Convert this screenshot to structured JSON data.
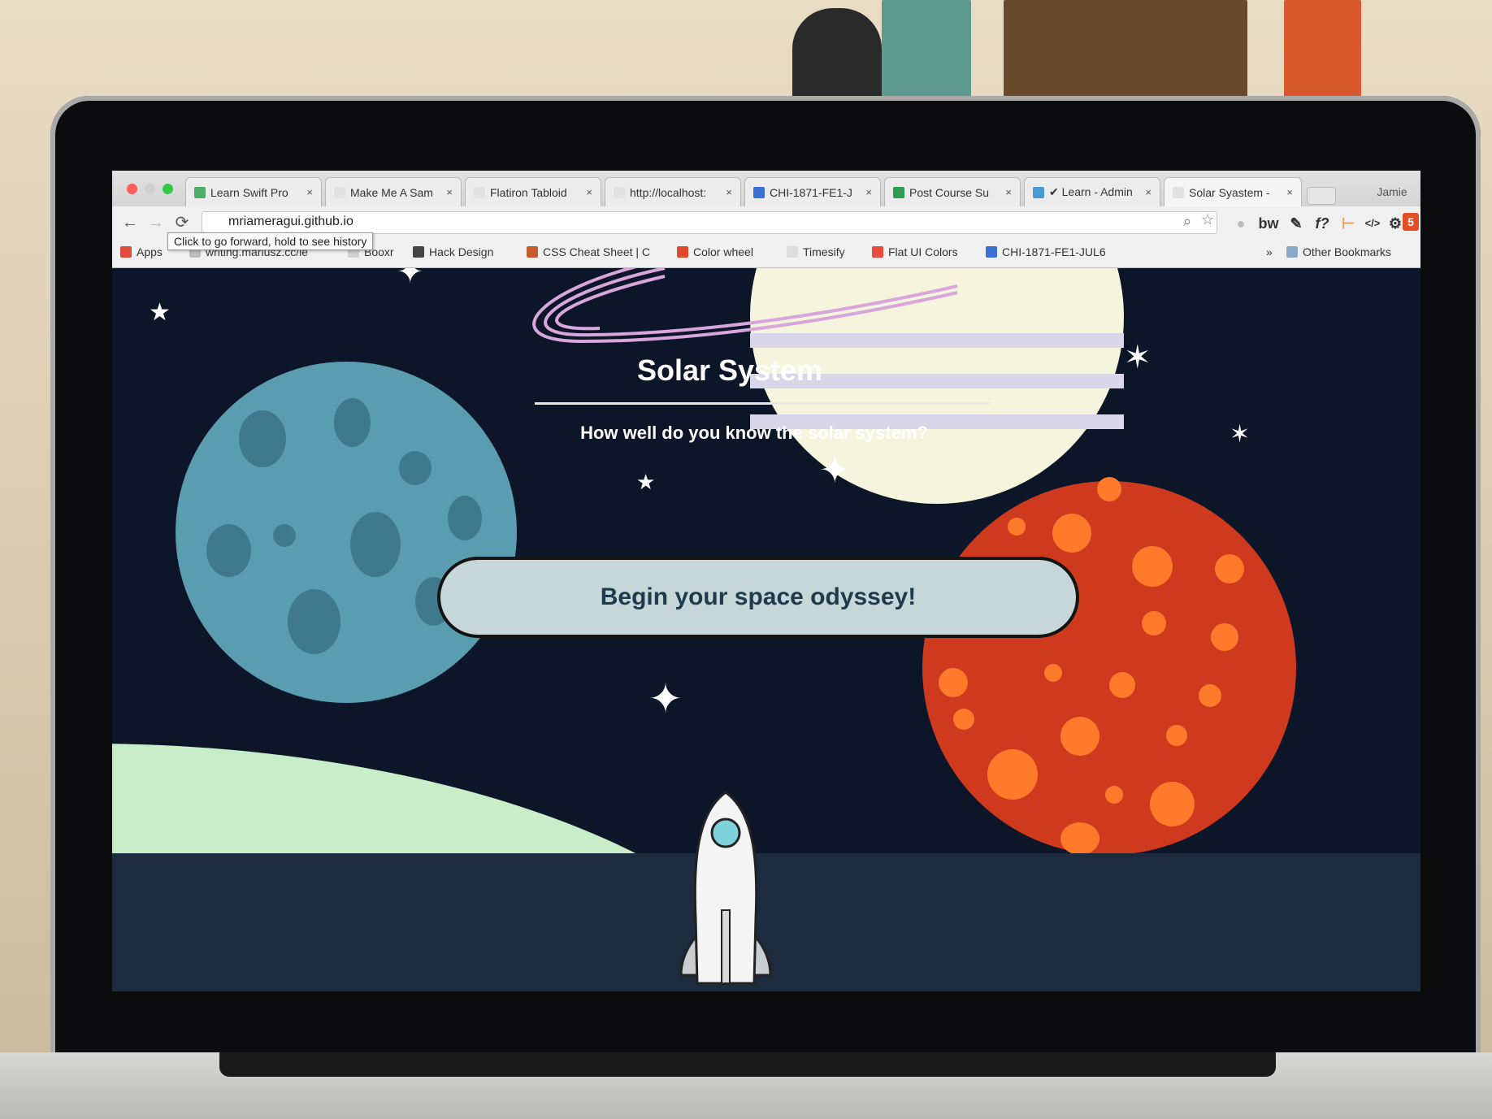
{
  "browser": {
    "tabs": [
      {
        "label": "Learn Swift Pro",
        "favicon_color": "#4cae6a"
      },
      {
        "label": "Make Me A Sam",
        "favicon_color": "#e2e2e2"
      },
      {
        "label": "Flatiron Tabloid",
        "favicon_color": "#e2e2e2"
      },
      {
        "label": "http://localhost:",
        "favicon_color": "#e2e2e2"
      },
      {
        "label": "CHI-1871-FE1-J",
        "favicon_color": "#3b6fd4"
      },
      {
        "label": "Post Course Su",
        "favicon_color": "#2e9a52"
      },
      {
        "label": "✔ Learn - Admin",
        "favicon_color": "#4a9ad8"
      },
      {
        "label": "Solar Syastem -",
        "favicon_color": "#e2e2e2"
      }
    ],
    "profile_name": "Jamie",
    "close_glyph": "×",
    "address": "mriameragui.github.io",
    "tooltip": "Click to go forward, hold to see history",
    "nav": {
      "back": "←",
      "forward": "→",
      "reload": "⟳"
    },
    "bookmarks": [
      {
        "label": "Apps",
        "icon_color": "#e24c3c"
      },
      {
        "label": "writing.mariusz.cc/le",
        "icon_color": "#bdbdbd"
      },
      {
        "label": "Booxr",
        "icon_color": "#cfcfcf"
      },
      {
        "label": "Hack Design",
        "icon_color": "#444444"
      },
      {
        "label": "CSS Cheat Sheet | C",
        "icon_color": "#c55a2a"
      },
      {
        "label": "Color wheel",
        "icon_color": "#e04a2a"
      },
      {
        "label": "Timesify",
        "icon_color": "#dddddd"
      },
      {
        "label": "Flat UI Colors",
        "icon_color": "#e84c3d"
      },
      {
        "label": "CHI-1871-FE1-JUL6",
        "icon_color": "#3b6fd4"
      }
    ],
    "bookmarks_overflow": "»",
    "other_bookmarks": "Other Bookmarks",
    "extensions": [
      {
        "name": "bw-icon",
        "glyph": "bw"
      },
      {
        "name": "eyedropper-icon",
        "glyph": "✎"
      },
      {
        "name": "function-icon",
        "glyph": "f?"
      },
      {
        "name": "ruler-icon",
        "glyph": "⊢"
      },
      {
        "name": "code-icon",
        "glyph": "</>"
      },
      {
        "name": "gear-icon",
        "glyph": "⚙"
      },
      {
        "name": "html5-icon",
        "glyph": "5"
      },
      {
        "name": "menu-icon",
        "glyph": "≡"
      }
    ]
  },
  "page": {
    "title": "Solar System",
    "subtitle": "How well do you know the solar system?",
    "cta_label": "Begin your space odyssey!"
  },
  "colors": {
    "space": "#0d1628",
    "blue_planet": "#5b9db0",
    "red_planet": "#cf3a1f",
    "cta_bg": "#c5d7d8",
    "cta_text": "#1f3b4d"
  }
}
